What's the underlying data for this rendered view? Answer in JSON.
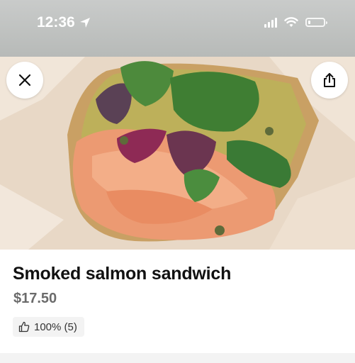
{
  "status_bar": {
    "time": "12:36",
    "icons": [
      "location-arrow-icon",
      "cellular-signal-icon",
      "wifi-icon",
      "battery-icon"
    ],
    "battery_level": 0.15
  },
  "hero": {
    "image": "photo of a smoked salmon open-face sandwich with greens on parchment paper",
    "close_icon": "close-icon",
    "share_icon": "share-icon"
  },
  "item": {
    "name": "Smoked salmon sandwich",
    "price": "$17.50",
    "rating": "100% (5)",
    "rating_icon": "thumbs-up-icon"
  },
  "colors": {
    "status_bar_bg": "#bfc2c0",
    "text_primary": "#111111",
    "text_secondary": "#6b6b6b",
    "badge_bg": "#f3f3f3"
  }
}
